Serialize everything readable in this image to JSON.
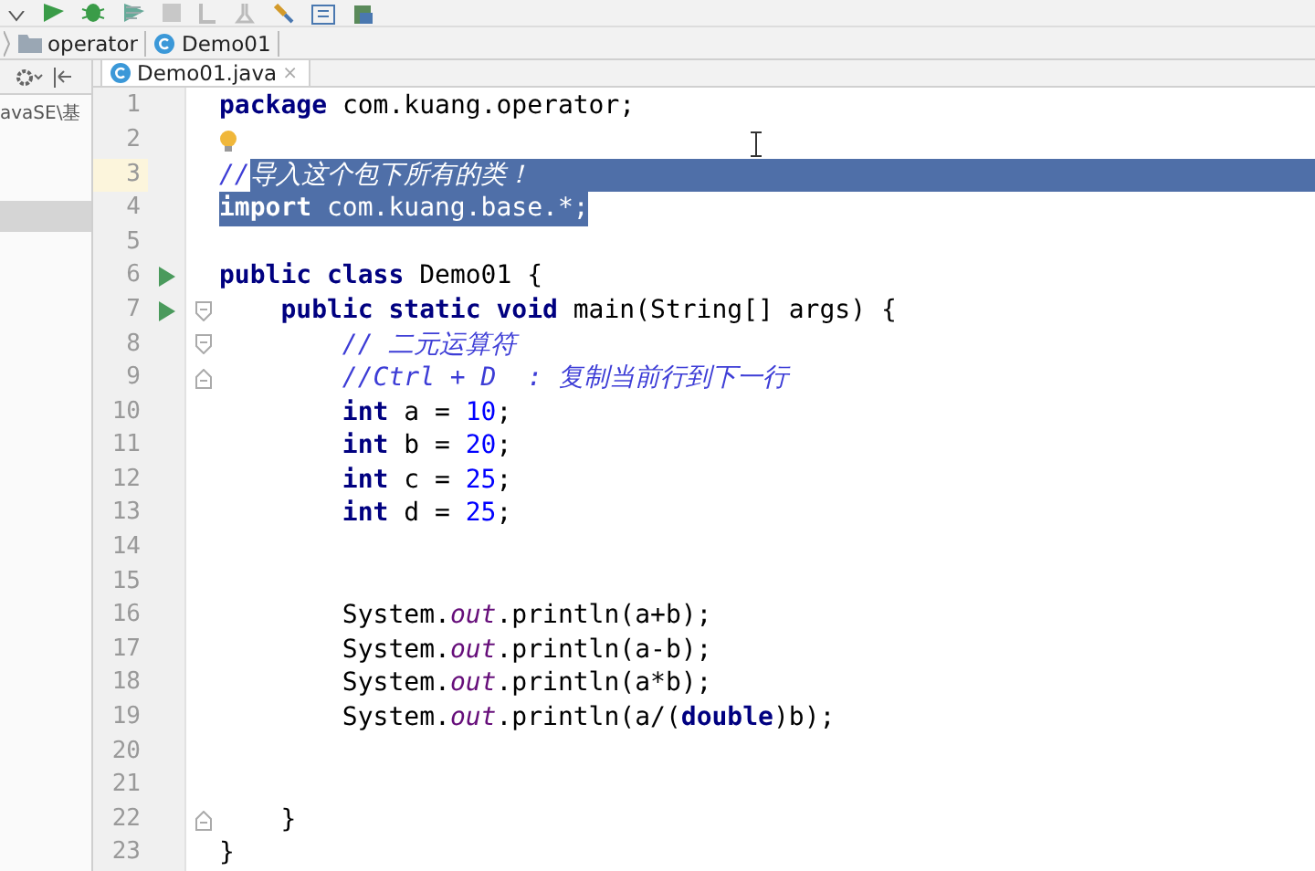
{
  "breadcrumbs": [
    {
      "label": "operator",
      "kind": "folder"
    },
    {
      "label": "Demo01",
      "kind": "class"
    }
  ],
  "project_panel": {
    "items": [
      {
        "label": "avaSE\\基",
        "selected": false
      },
      {
        "selected": true
      }
    ]
  },
  "tabs": [
    {
      "label": "Demo01.java",
      "close": "×",
      "selected": true
    }
  ],
  "editor": {
    "lines": [
      {
        "number": "1",
        "tokens": [
          {
            "text": "package",
            "kind": "keyword",
            "selected": false
          },
          {
            "text": " com.kuang.operator;",
            "kind": "plain",
            "selected": false
          }
        ]
      },
      {
        "number": "2",
        "bulb": true
      },
      {
        "number": "3",
        "current": true,
        "selection_to_edge": true,
        "tokens": [
          {
            "text": "//",
            "kind": "comment",
            "selected": false
          },
          {
            "text": "导入这个包下所有的类！",
            "kind": "comment",
            "selected": true
          }
        ]
      },
      {
        "number": "4",
        "tokens": [
          {
            "text": "import",
            "kind": "keyword",
            "selected": true
          },
          {
            "text": " com.kuang.base.*;",
            "kind": "plain",
            "selected": true
          }
        ]
      },
      {
        "number": "5"
      },
      {
        "number": "6",
        "run_marker": true,
        "tokens": [
          {
            "text": "public class",
            "kind": "keyword",
            "selected": false
          },
          {
            "text": " Demo01 {",
            "kind": "plain",
            "selected": false
          }
        ]
      },
      {
        "number": "7",
        "run_marker": true,
        "fold_start": true,
        "tokens": [
          {
            "text": "    public static void",
            "kind": "keyword",
            "selected": false
          },
          {
            "text": " main(String[] args) {",
            "kind": "plain",
            "selected": false
          }
        ]
      },
      {
        "number": "8",
        "fold_start": true,
        "tokens": [
          {
            "text": "        // 二元运算符",
            "kind": "comment",
            "selected": false
          }
        ]
      },
      {
        "number": "9",
        "fold_end": true,
        "tokens": [
          {
            "text": "        //Ctrl + D  : 复制当前行到下一行",
            "kind": "comment",
            "selected": false
          }
        ]
      },
      {
        "number": "10",
        "tokens": [
          {
            "text": "        int",
            "kind": "keyword",
            "selected": false
          },
          {
            "text": " a = ",
            "kind": "plain",
            "selected": false
          },
          {
            "text": "10",
            "kind": "number",
            "selected": false
          },
          {
            "text": ";",
            "kind": "plain",
            "selected": false
          }
        ]
      },
      {
        "number": "11",
        "tokens": [
          {
            "text": "        int",
            "kind": "keyword",
            "selected": false
          },
          {
            "text": " b = ",
            "kind": "plain",
            "selected": false
          },
          {
            "text": "20",
            "kind": "number",
            "selected": false
          },
          {
            "text": ";",
            "kind": "plain",
            "selected": false
          }
        ]
      },
      {
        "number": "12",
        "tokens": [
          {
            "text": "        int",
            "kind": "keyword",
            "selected": false
          },
          {
            "text": " c = ",
            "kind": "plain",
            "selected": false
          },
          {
            "text": "25",
            "kind": "number",
            "selected": false
          },
          {
            "text": ";",
            "kind": "plain",
            "selected": false
          }
        ]
      },
      {
        "number": "13",
        "tokens": [
          {
            "text": "        int",
            "kind": "keyword",
            "selected": false
          },
          {
            "text": " d = ",
            "kind": "plain",
            "selected": false
          },
          {
            "text": "25",
            "kind": "number",
            "selected": false
          },
          {
            "text": ";",
            "kind": "plain",
            "selected": false
          }
        ]
      },
      {
        "number": "14"
      },
      {
        "number": "15"
      },
      {
        "number": "16",
        "tokens": [
          {
            "text": "        System.",
            "kind": "plain",
            "selected": false
          },
          {
            "text": "out",
            "kind": "field",
            "selected": false
          },
          {
            "text": ".println(a+b);",
            "kind": "plain",
            "selected": false
          }
        ]
      },
      {
        "number": "17",
        "tokens": [
          {
            "text": "        System.",
            "kind": "plain",
            "selected": false
          },
          {
            "text": "out",
            "kind": "field",
            "selected": false
          },
          {
            "text": ".println(a-b);",
            "kind": "plain",
            "selected": false
          }
        ]
      },
      {
        "number": "18",
        "tokens": [
          {
            "text": "        System.",
            "kind": "plain",
            "selected": false
          },
          {
            "text": "out",
            "kind": "field",
            "selected": false
          },
          {
            "text": ".println(a*b);",
            "kind": "plain",
            "selected": false
          }
        ]
      },
      {
        "number": "19",
        "tokens": [
          {
            "text": "        System.",
            "kind": "plain",
            "selected": false
          },
          {
            "text": "out",
            "kind": "field",
            "selected": false
          },
          {
            "text": ".println(a/(",
            "kind": "plain",
            "selected": false
          },
          {
            "text": "double",
            "kind": "keyword",
            "selected": false
          },
          {
            "text": ")b);",
            "kind": "plain",
            "selected": false
          }
        ]
      },
      {
        "number": "20"
      },
      {
        "number": "21"
      },
      {
        "number": "22",
        "fold_end": true,
        "tokens": [
          {
            "text": "    }",
            "kind": "plain",
            "selected": false
          }
        ]
      },
      {
        "number": "23",
        "tokens": [
          {
            "text": "}",
            "kind": "plain",
            "selected": false
          }
        ]
      }
    ]
  }
}
